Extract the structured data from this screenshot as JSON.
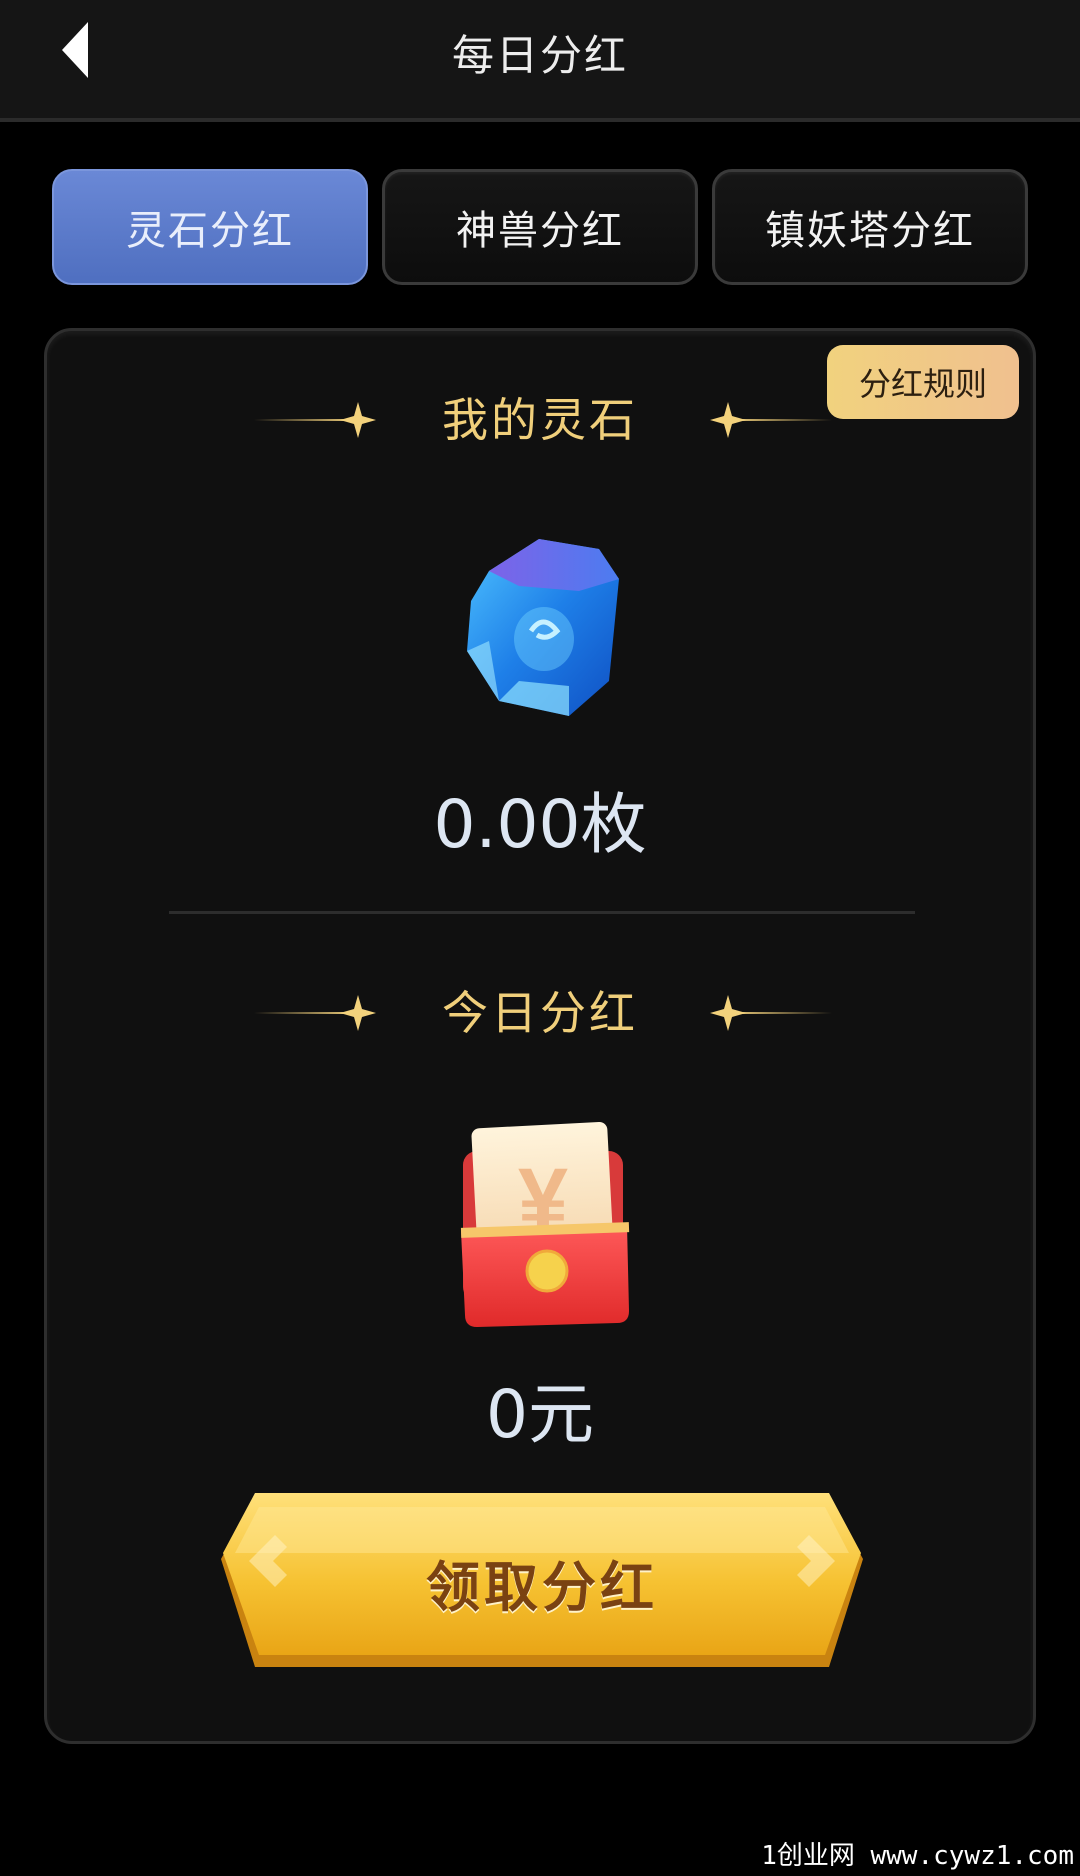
{
  "header": {
    "title": "每日分红",
    "back_icon": "back-arrow-icon"
  },
  "tabs": [
    {
      "label": "灵石分红",
      "active": true
    },
    {
      "label": "神兽分红",
      "active": false
    },
    {
      "label": "镇妖塔分红",
      "active": false
    }
  ],
  "card": {
    "rule_badge": "分红规则",
    "stones": {
      "title": "我的灵石",
      "icon": "blue-gem-icon",
      "value": "0.00枚"
    },
    "today": {
      "title": "今日分红",
      "icon": "red-envelope-yuan-icon",
      "value": "0元"
    },
    "claim_button": "领取分红"
  },
  "watermark": "1创业网 www.cywz1.com",
  "colors": {
    "background": "#000000",
    "active_tab": "#5a7acb",
    "gold_text": "#f0cf7b",
    "value_text": "#dde6f2",
    "button_gold": "#f4c433"
  }
}
